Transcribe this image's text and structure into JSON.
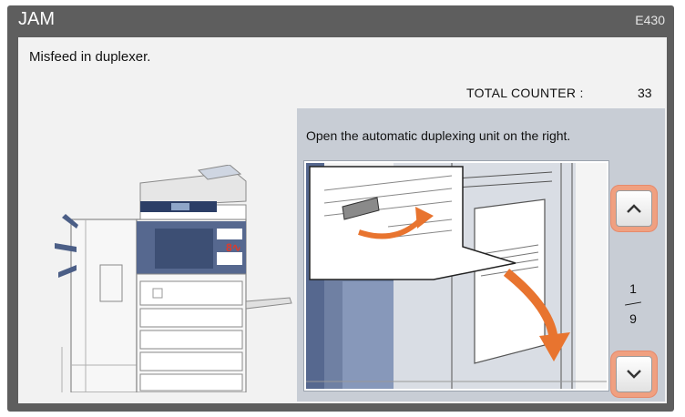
{
  "header": {
    "title": "JAM",
    "error_code": "E430"
  },
  "message": "Misfeed in duplexer.",
  "counter": {
    "label": "TOTAL COUNTER :",
    "value": "33"
  },
  "guide": {
    "instruction": "Open the automatic duplexing unit on the right.",
    "page": {
      "current": "1",
      "total": "9"
    },
    "up_icon": "chevron-up-icon",
    "down_icon": "chevron-down-icon"
  },
  "machine": {
    "jam_marks": [
      "8♈",
      "8♈"
    ]
  },
  "colors": {
    "frame": "#5e5e5e",
    "panel": "#f2f2f2",
    "guide": "#c8cdd5",
    "highlight": "#e68a6b",
    "arrow": "#e8742f"
  }
}
